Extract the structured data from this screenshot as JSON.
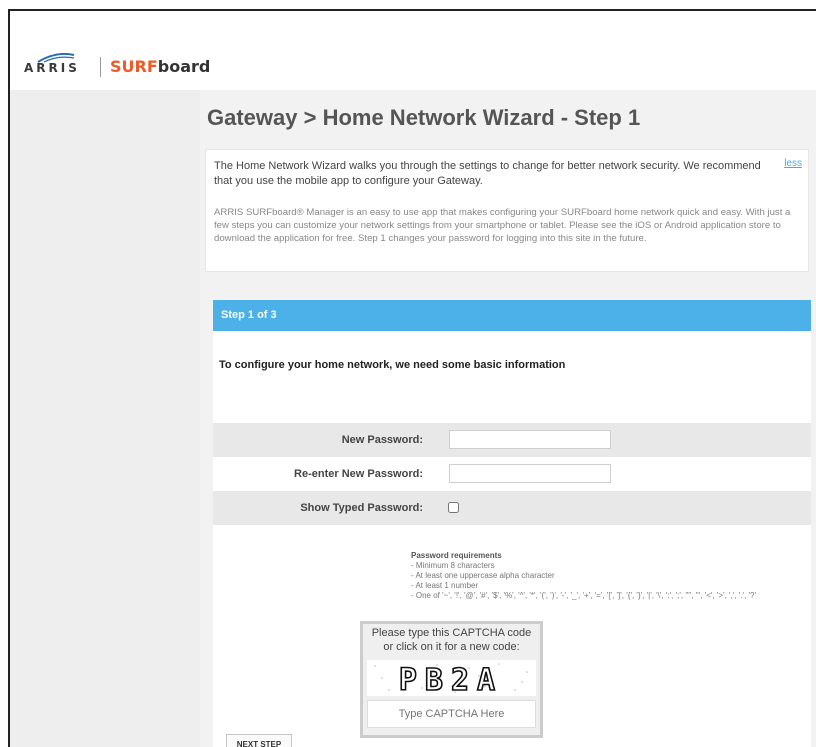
{
  "brand": {
    "arris": "ARRIS",
    "surf": "SURF",
    "board": "board"
  },
  "page": {
    "title": "Gateway > Home Network Wizard - Step 1"
  },
  "info": {
    "intro": "The Home Network Wizard walks you through the settings to change for better network security. We recommend that you use the mobile app to configure your Gateway.",
    "less_link": "less",
    "body": "ARRIS SURFboard® Manager is an easy to use app that makes configuring your SURFboard home network quick and easy. With just a few steps you can customize your network settings from your smartphone or tablet. Please see the iOS or Android application store to download the application for free. Step 1 changes your password for logging into this site in the future."
  },
  "step": {
    "header": "Step 1 of 3",
    "intro": "To configure your home network, we need some basic information"
  },
  "form": {
    "new_password_label": "New Password:",
    "reenter_password_label": "Re-enter New Password:",
    "show_password_label": "Show Typed Password:"
  },
  "requirements": {
    "heading": "Password requirements",
    "items": [
      "- Minimum 8 characters",
      "- At least one uppercase alpha character",
      "- At least 1 number",
      "- One of '~', '!', '@', '#', '$', '%', '^', '*', '(', ')', '-', '_', '+', '=', '[', ']', '{', '}', '|', '\\', ':', ';', '\"', ''', '<', '>', ',', '.', '?'"
    ]
  },
  "captcha": {
    "prompt_line1": "Please type this CAPTCHA code",
    "prompt_line2": "or click on it for a new code:",
    "code": "PB2A",
    "placeholder": "Type CAPTCHA Here"
  },
  "buttons": {
    "next_step": "NEXT STEP"
  },
  "colors": {
    "step_header": "#4bb1e8",
    "brand_orange": "#f05a28",
    "link": "#4aa8e0"
  }
}
